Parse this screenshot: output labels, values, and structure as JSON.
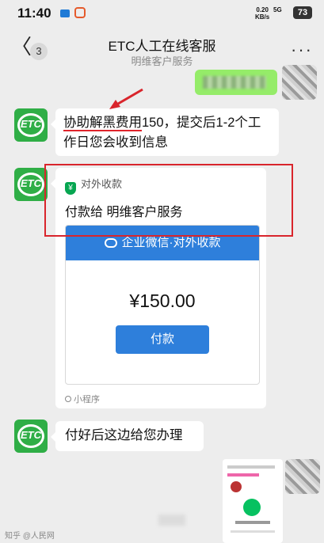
{
  "status_bar": {
    "time": "11:40",
    "net_speed_value": "0.20",
    "net_speed_unit": "KB/s",
    "signal": "5G",
    "battery": "73"
  },
  "header": {
    "back_glyph": "〈",
    "unread_count": "3",
    "title": "ETC人工在线客服",
    "subtitle": "明维客户服务",
    "more_glyph": "···"
  },
  "messages": {
    "m1_part1": "协助解黑费用",
    "m1_part2": "150，提交后1-2个工作日您会收到信息",
    "avatar_label": "ETC",
    "card": {
      "source_icon": "¥",
      "source_label": "对外收款",
      "payee": "付款给 明维客户服务",
      "banner": "企业微信·对外收款",
      "amount": "¥150.00",
      "pay_button": "付款",
      "mini_program": "小程序"
    },
    "m3": "付好后这边给您办理"
  },
  "watermark": "知乎 @人民网",
  "colors": {
    "accent_green": "#2fae46",
    "bubble_out": "#95ec69",
    "pay_blue": "#2e7fdb",
    "highlight_red": "#d9252c"
  }
}
